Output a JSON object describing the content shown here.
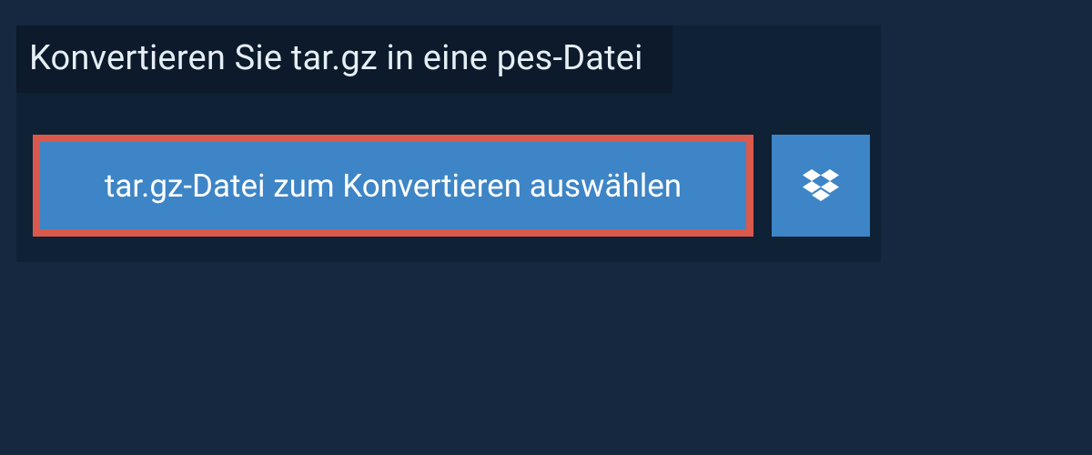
{
  "heading": "Konvertieren Sie tar.gz in eine pes-Datei",
  "select_button": {
    "label": "tar.gz-Datei zum Konvertieren auswählen"
  },
  "dropbox_button": {
    "icon": "dropbox-icon"
  },
  "colors": {
    "page_bg": "#15283f",
    "panel_bg": "#0e2135",
    "heading_bg": "#0c1a2b",
    "button_bg": "#3d85c6",
    "highlight_border": "#d9594c",
    "text_light": "#ffffff"
  }
}
